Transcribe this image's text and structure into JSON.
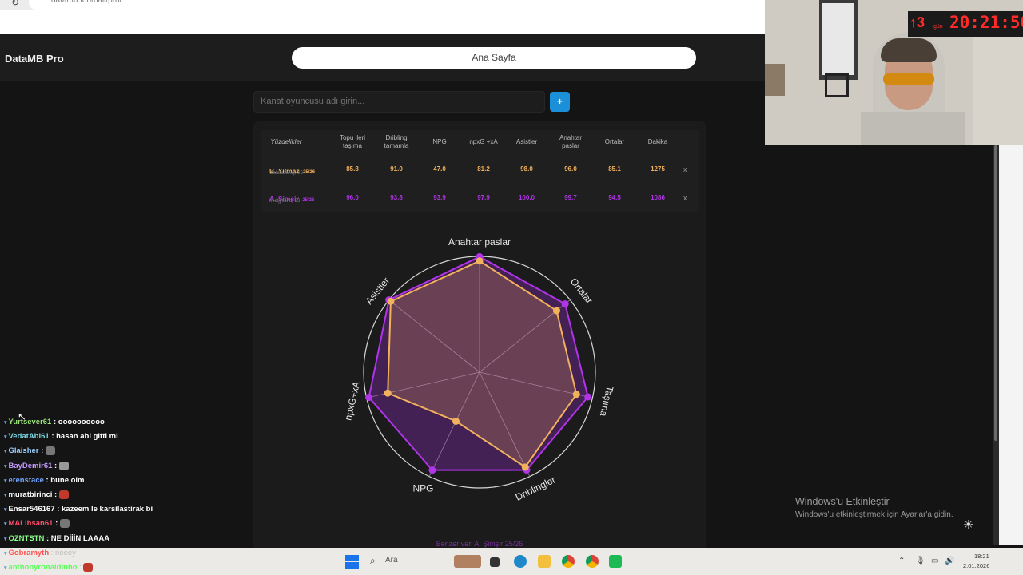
{
  "browser": {
    "url": "datamb.football/pro/",
    "reload_icon": "reload-icon"
  },
  "header": {
    "brand": "DataMB Pro",
    "home_label": "Ana Sayfa"
  },
  "search": {
    "placeholder": "Kanat oyuncusu adı girin...",
    "add_label": "+"
  },
  "table": {
    "headers": [
      "Yüzdelikler",
      "Topu ileri\ntaşıma",
      "Dribling\ntamamla",
      "NPG",
      "npxG +xA",
      "Asistler",
      "Anahtar\npaslar",
      "Ortalar",
      "Dakika"
    ],
    "rows": [
      {
        "name": "B. Yılmaz",
        "season": "25/26",
        "club": "Galatasaray, 26",
        "values": [
          "85.8",
          "91.0",
          "47.0",
          "81.2",
          "98.0",
          "96.0",
          "85.1",
          "1275"
        ],
        "color": "#f2b15c",
        "remove": "x"
      },
      {
        "name": "A. Şimşir",
        "season": "25/26",
        "club": "Midtjylland, 23",
        "values": [
          "96.0",
          "93.8",
          "93.9",
          "97.9",
          "100.0",
          "99.7",
          "94.5",
          "1086"
        ],
        "color": "#b034e8",
        "remove": "x"
      }
    ]
  },
  "chart_data": {
    "type": "radar",
    "axes": [
      "Anahtar paslar",
      "Ortalar",
      "Taşıma",
      "Driblingler",
      "NPG",
      "npxG+xA",
      "Asistler"
    ],
    "range": [
      0,
      100
    ],
    "series": [
      {
        "name": "B. Yılmaz",
        "values": [
          96.0,
          85.1,
          85.8,
          91.0,
          47.0,
          81.2,
          98.0
        ],
        "color": "#f2b15c"
      },
      {
        "name": "A. Şimşir",
        "values": [
          99.7,
          94.5,
          96.0,
          93.8,
          93.9,
          97.9,
          100.0
        ],
        "color": "#b034e8"
      }
    ]
  },
  "similar_text": "Benzer veri A. Şimşir 25/26",
  "stream": {
    "timer": "20:21:50",
    "timer_prefix": "↑3",
    "timer_unit": "gün",
    "chat": [
      {
        "user": "Yurtsever61",
        "msg": ": oooooooooo",
        "color": "#9be37a"
      },
      {
        "user": "VedatAbi61",
        "msg": ": hasan abi gitti mi",
        "color": "#7ad7e3"
      },
      {
        "user": "Glaisher",
        "msg": ":",
        "color": "#9ad0ff",
        "emote": true
      },
      {
        "user": "BayDemir61",
        "msg": ":",
        "color": "#c49bff",
        "emote": true
      },
      {
        "user": "erenstace",
        "msg": ": bune olm",
        "color": "#6fa3ff"
      },
      {
        "user": "muratbirinci",
        "msg": ":",
        "color": "#ffffff",
        "emote": true
      },
      {
        "user": "Ensar546167",
        "msg": ": kazeem le karsilastirak bi",
        "color": "#ffffff"
      },
      {
        "user": "MALihsan61",
        "msg": ":",
        "color": "#ff4d6d",
        "emote": true
      },
      {
        "user": "OZNTSTN",
        "msg": ": NE DİİİN LAAAA",
        "color": "#8cff8c"
      },
      {
        "user": "Gobramyth",
        "msg": ": neeey",
        "color": "#ff5050"
      },
      {
        "user": "anthonyronaldinho",
        "msg": ":",
        "color": "#5cff5c",
        "emote": true
      }
    ]
  },
  "windows": {
    "activate_title": "Windows'u Etkinleştir",
    "activate_sub": "Windows'u etkinleştirmek için Ayarlar'a gidin.",
    "search_label": "Ara",
    "time": "18:21",
    "date": "2.01.2026"
  }
}
